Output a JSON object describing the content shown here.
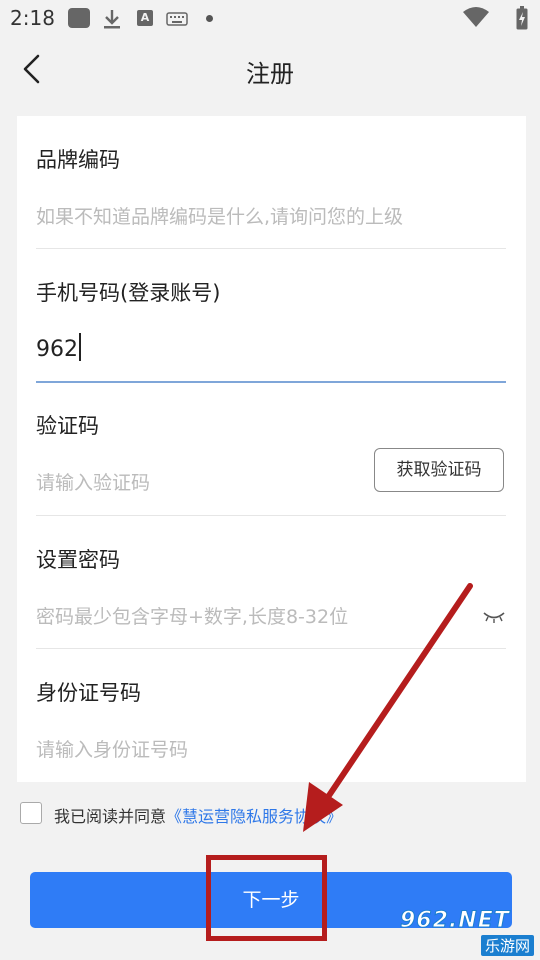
{
  "status_bar": {
    "time": "2:18",
    "icons": [
      "gallery-icon",
      "download-icon",
      "a-badge-icon",
      "keyboard-icon",
      "dot-icon",
      "wifi-icon",
      "battery-icon"
    ]
  },
  "header": {
    "title": "注册",
    "back_icon": "chevron-left-icon"
  },
  "form": {
    "brand_code": {
      "label": "品牌编码",
      "placeholder": "如果不知道品牌编码是什么,请询问您的上级"
    },
    "phone": {
      "label": "手机号码(登录账号)",
      "value": "962"
    },
    "verify_code": {
      "label": "验证码",
      "placeholder": "请输入验证码",
      "button": "获取验证码"
    },
    "password": {
      "label": "设置密码",
      "placeholder": "密码最少包含字母+数字,长度8-32位",
      "toggle_icon": "eye-closed-icon"
    },
    "id_number": {
      "label": "身份证号码",
      "placeholder": "请输入身份证号码"
    }
  },
  "agreement": {
    "checked": false,
    "text": "我已阅读并同意",
    "link": "《慧运营隐私服务协议》"
  },
  "next_button": "下一步",
  "colors": {
    "primary": "#2f7cf6",
    "link": "#2f78e8",
    "annotation": "#b51d1d",
    "background": "#f2f2f2"
  },
  "watermark": {
    "top": "962.NET",
    "bottom": "乐游网"
  }
}
